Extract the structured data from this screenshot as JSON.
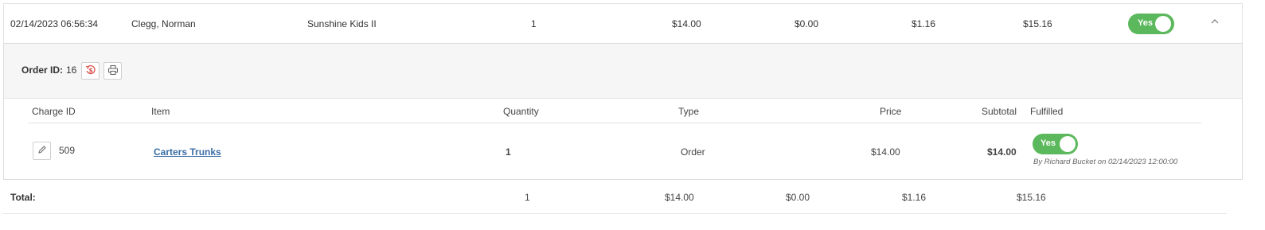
{
  "order_row": {
    "datetime": "02/14/2023 06:56:34",
    "customer": "Clegg, Norman",
    "program": "Sunshine Kids II",
    "quantity": "1",
    "amount": "$14.00",
    "discount": "$0.00",
    "tax": "$1.16",
    "total": "$15.16",
    "paid_toggle": "Yes",
    "collapse_icon": "chevron-up-icon"
  },
  "detail": {
    "order_label": "Order ID:",
    "order_id": "16",
    "refund_icon": "refund-dollar-icon",
    "print_icon": "printer-icon",
    "columns": {
      "charge_id": "Charge ID",
      "item": "Item",
      "quantity": "Quantity",
      "type": "Type",
      "price": "Price",
      "subtotal": "Subtotal",
      "fulfilled": "Fulfilled"
    },
    "charges": [
      {
        "edit_icon": "pencil-icon",
        "charge_id": "509",
        "item": "Carters Trunks",
        "quantity": "1",
        "type": "Order",
        "price": "$14.00",
        "subtotal": "$14.00",
        "fulfilled_toggle": "Yes",
        "fulfilled_note": "By Richard Bucket on 02/14/2023 12:00:00"
      }
    ]
  },
  "totals": {
    "label": "Total:",
    "quantity": "1",
    "amount": "$14.00",
    "discount": "$0.00",
    "tax": "$1.16",
    "total": "$15.16"
  },
  "colors": {
    "toggle_on": "#5cb85c",
    "link": "#3b6ea5",
    "refund_icon": "#d9534f"
  }
}
